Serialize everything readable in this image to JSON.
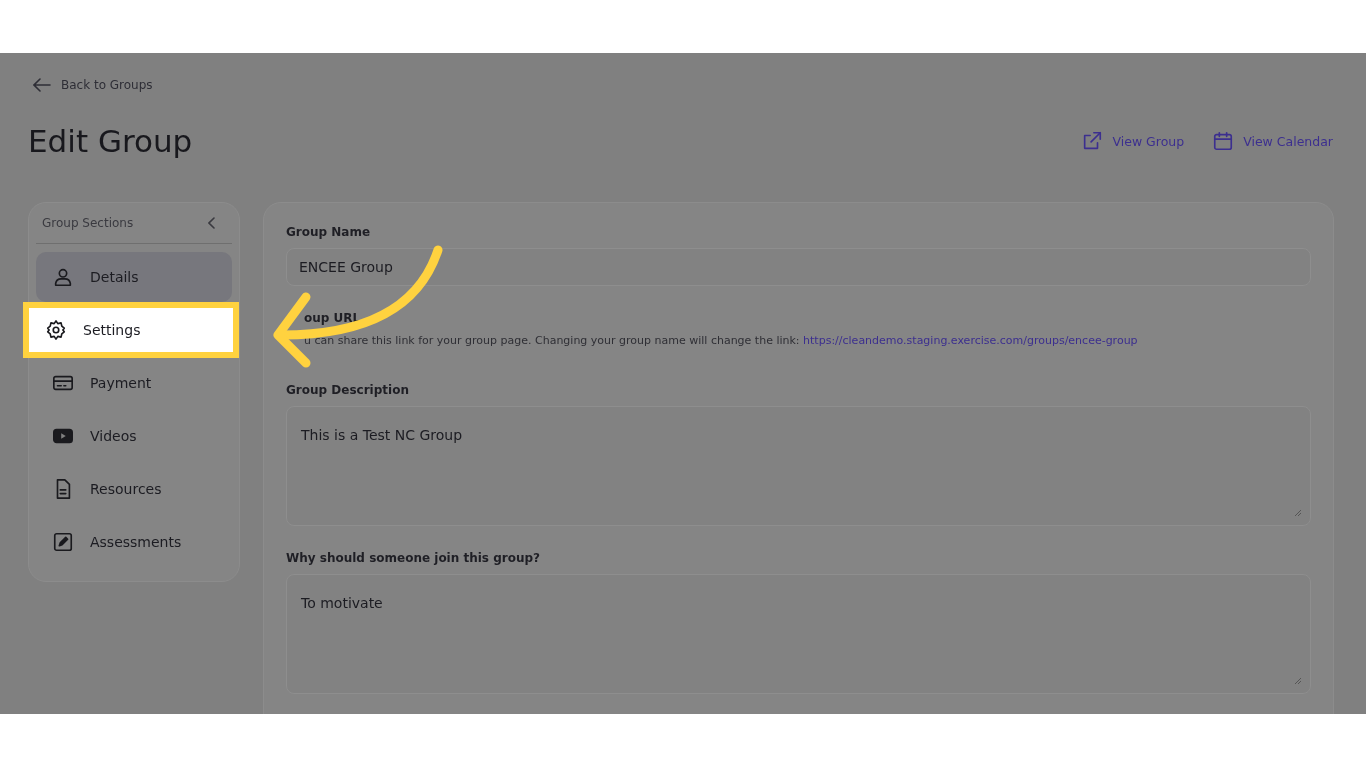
{
  "back_link": {
    "label": "Back to Groups"
  },
  "title": "Edit Group",
  "header_actions": [
    {
      "kind": "external",
      "label": "View Group"
    },
    {
      "kind": "calendar",
      "label": "View Calendar"
    }
  ],
  "sidebar": {
    "title": "Group Sections",
    "items": [
      {
        "kind": "person",
        "label": "Details",
        "selected": true,
        "highlighted": false
      },
      {
        "kind": "gear",
        "label": "Settings",
        "selected": false,
        "highlighted": true
      },
      {
        "kind": "card",
        "label": "Payment",
        "selected": false,
        "highlighted": false
      },
      {
        "kind": "video",
        "label": "Videos",
        "selected": false,
        "highlighted": false
      },
      {
        "kind": "document",
        "label": "Resources",
        "selected": false,
        "highlighted": false
      },
      {
        "kind": "pen",
        "label": "Assessments",
        "selected": false,
        "highlighted": false
      }
    ]
  },
  "form": {
    "group_name": {
      "label": "Group Name",
      "value": "ENCEE Group"
    },
    "group_url": {
      "label": "oup URL",
      "help": "u can share this link for your group page. Changing your group name will change the link:",
      "link": "https://cleandemo.staging.exercise.com/groups/encee-group"
    },
    "description": {
      "label": "Group Description",
      "value": "This is a Test NC Group"
    },
    "why_join": {
      "label": "Why should someone join this group?",
      "value": "To motivate"
    }
  }
}
